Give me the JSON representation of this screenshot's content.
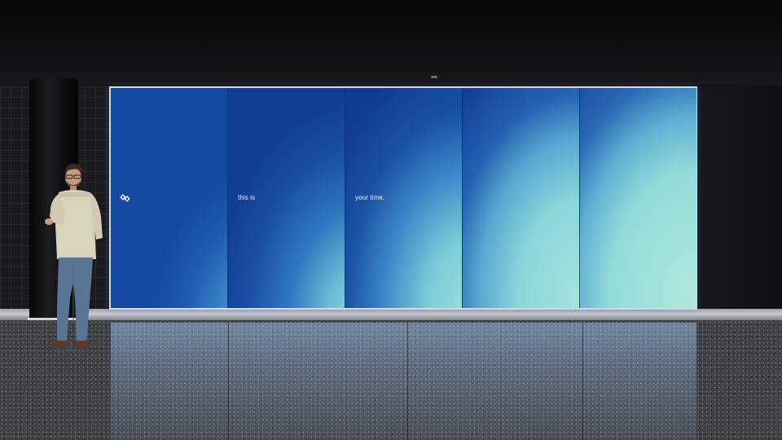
{
  "display": {
    "panel_1_logo": "logo-mark-icon",
    "panel_2_text": "this is",
    "panel_3_text": "your time.",
    "panel_count": 5
  },
  "colors": {
    "screen_deep_blue": "#154aa0",
    "screen_light_aqua": "#9ee0da",
    "screen_text": "#eef4ff",
    "wall": "#121214",
    "floor": "#3f4146"
  },
  "scene": {
    "subject": "person-icon",
    "object": "smartphone-icon"
  }
}
